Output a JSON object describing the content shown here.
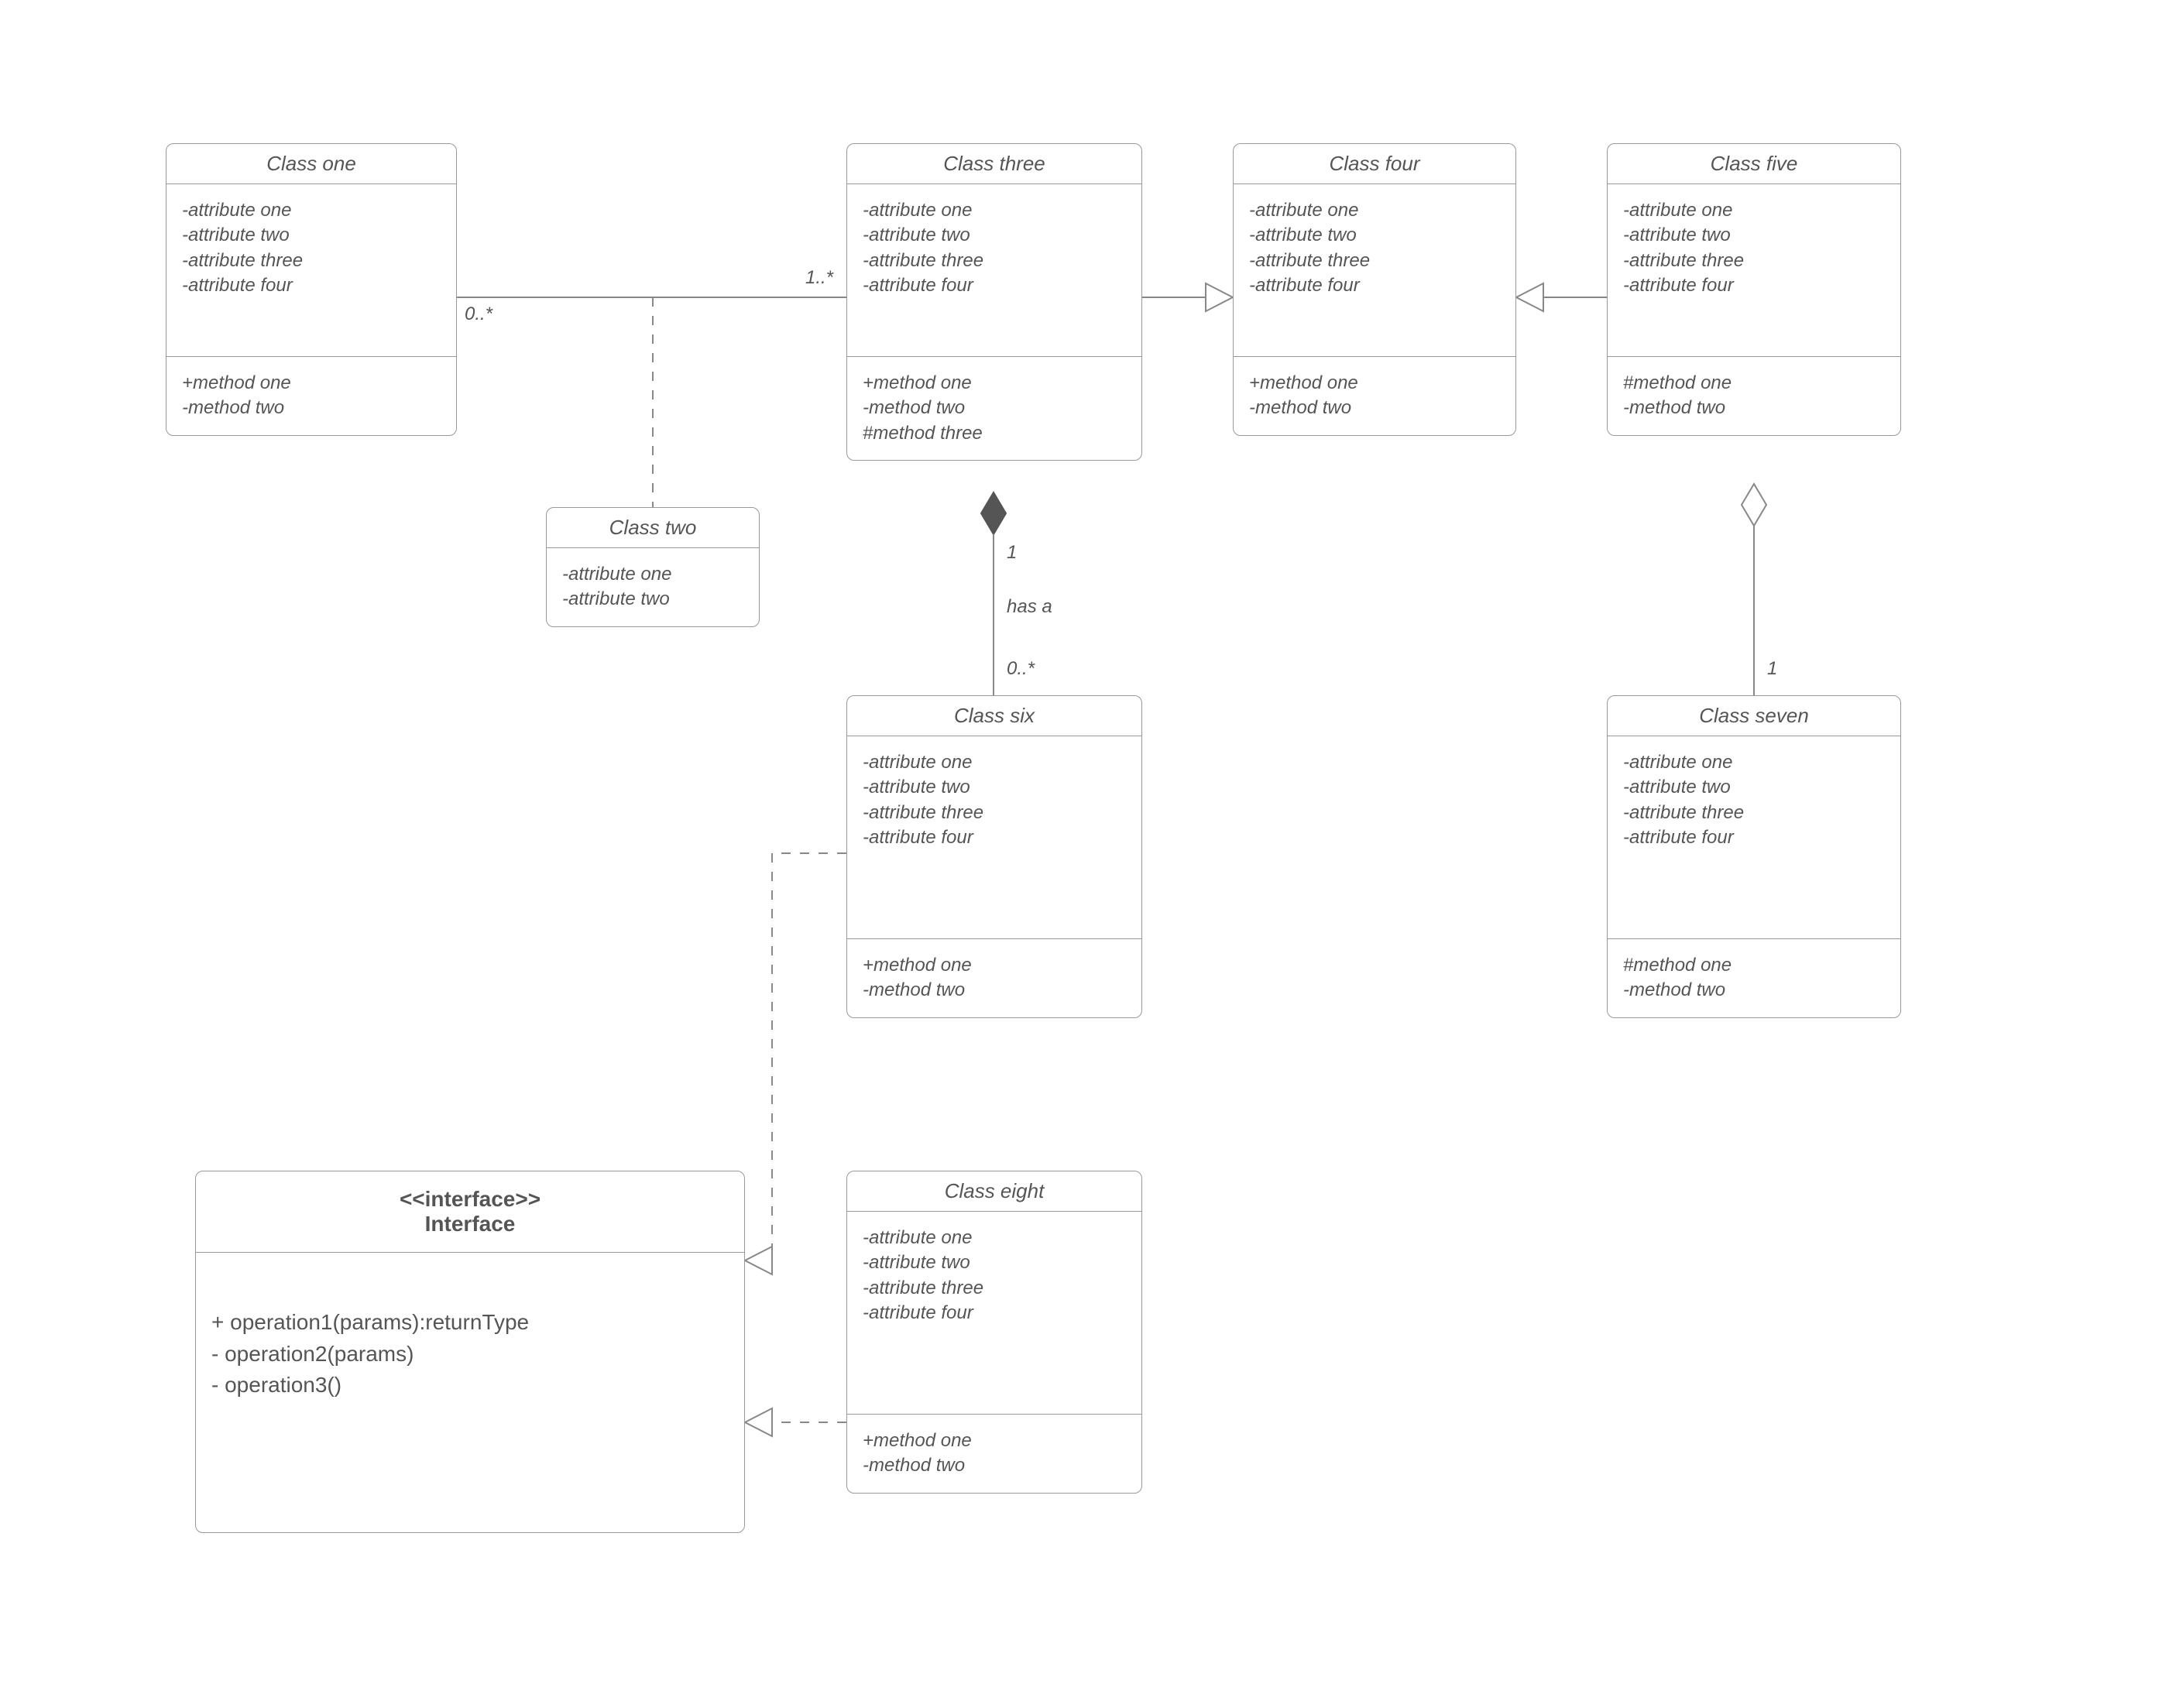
{
  "classes": {
    "c1": {
      "title": "Class one",
      "attrs": [
        "-attribute one",
        "-attribute two",
        "-attribute  three",
        "-attribute four"
      ],
      "methods": [
        "+method one",
        "-method two"
      ]
    },
    "c2": {
      "title": "Class two",
      "attrs": [
        "-attribute one",
        "-attribute two"
      ]
    },
    "c3": {
      "title": "Class three",
      "attrs": [
        "-attribute one",
        "-attribute two",
        "-attribute  three",
        "-attribute four"
      ],
      "methods": [
        "+method one",
        "-method two",
        "#method three"
      ]
    },
    "c4": {
      "title": "Class four",
      "attrs": [
        "-attribute one",
        "-attribute two",
        "-attribute  three",
        "-attribute four"
      ],
      "methods": [
        "+method one",
        "-method two"
      ]
    },
    "c5": {
      "title": "Class five",
      "attrs": [
        "-attribute one",
        "-attribute two",
        "-attribute three",
        "-attribute four"
      ],
      "methods": [
        "#method one",
        "-method two"
      ]
    },
    "c6": {
      "title": "Class six",
      "attrs": [
        "-attribute one",
        "-attribute two",
        "-attribute  three",
        "-attribute four"
      ],
      "methods": [
        "+method one",
        "-method two"
      ]
    },
    "c7": {
      "title": "Class seven",
      "attrs": [
        "-attribute one",
        "-attribute two",
        "-attribute three",
        "-attribute four"
      ],
      "methods": [
        "#method one",
        "-method two"
      ]
    },
    "c8": {
      "title": "Class eight",
      "attrs": [
        "-attribute one",
        "-attribute two",
        "-attribute  three",
        "-attribute four"
      ],
      "methods": [
        "+method one",
        "-method two"
      ]
    },
    "iface": {
      "stereo": "<<interface>>",
      "title": "Interface",
      "ops": [
        "+ operation1(params):returnType",
        "- operation2(params)",
        "- operation3()"
      ]
    }
  },
  "labels": {
    "m_c1": "0..*",
    "m_c3a": "1..*",
    "m_comp_top": "1",
    "rel_has": "has a",
    "m_comp_bot": "0..*",
    "m_agg": "1"
  },
  "relationships": [
    {
      "type": "association",
      "from": "Class one",
      "to": "Class three",
      "from_mult": "0..*",
      "to_mult": "1..*"
    },
    {
      "type": "dependency",
      "from": "Class two",
      "to": "association(Class one,Class three)"
    },
    {
      "type": "generalization",
      "child": "Class three",
      "parent": "Class four"
    },
    {
      "type": "generalization",
      "child": "Class five",
      "parent": "Class four"
    },
    {
      "type": "composition",
      "whole": "Class three",
      "part": "Class six",
      "whole_mult": "1",
      "part_mult": "0..*",
      "label": "has a"
    },
    {
      "type": "aggregation",
      "whole": "Class five",
      "part": "Class seven",
      "part_mult": "1"
    },
    {
      "type": "realization",
      "class": "Class six",
      "interface": "Interface"
    },
    {
      "type": "realization",
      "class": "Class eight",
      "interface": "Interface"
    }
  ]
}
